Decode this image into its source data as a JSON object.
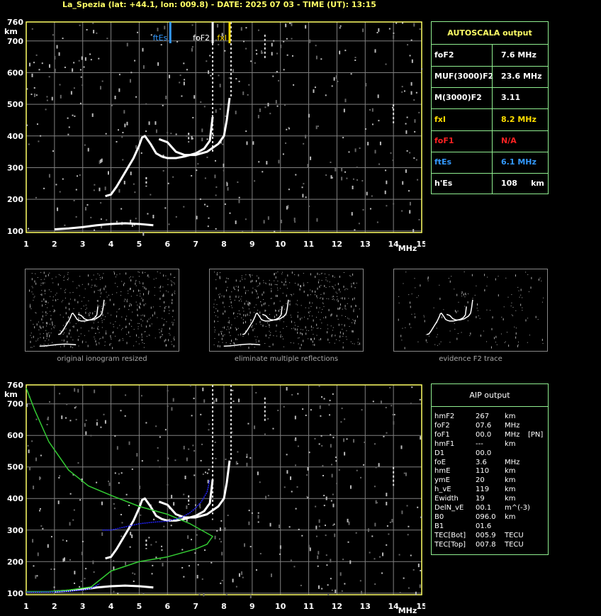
{
  "header": {
    "station": "La_Spezia",
    "text": "La_Spezia (lat: +44.1, lon: 009.8) - DATE: 2025 07 03 - TIME (UT): 13:15"
  },
  "colors": {
    "axis": "#ffff66",
    "grid": "#808080",
    "table_border": "#90ee90",
    "ftEs": "#3399ff",
    "foF2": "#ffffff",
    "fxI": "#ffdd00",
    "N_A": "#ff2222",
    "profile": "#33cc33",
    "aip_trace": "#2222ff"
  },
  "chart_data": [
    {
      "type": "scatter",
      "name": "main-ionogram",
      "xlabel": "MHz",
      "ylabel": "km",
      "xlim": [
        1,
        15
      ],
      "ylim": [
        95,
        760
      ],
      "xticks": [
        1,
        2,
        3,
        4,
        5,
        6,
        7,
        8,
        9,
        10,
        11,
        12,
        13,
        14,
        15
      ],
      "yticks": [
        100,
        200,
        300,
        400,
        500,
        600,
        700,
        760
      ],
      "grid": true,
      "markers": [
        {
          "label": "ftEs",
          "freq": 6.1,
          "color": "#3399ff"
        },
        {
          "label": "foF2",
          "freq": 7.6,
          "color": "#ffffff"
        },
        {
          "label": "fxI",
          "freq": 8.2,
          "color": "#ffdd00"
        }
      ],
      "series": [
        {
          "color": "#ffffff",
          "x": [
            3.8,
            4.0,
            4.2,
            4.4,
            4.6,
            4.8,
            5.0,
            5.1,
            5.2,
            5.4,
            5.6,
            5.8,
            6.0,
            6.3,
            6.6,
            7.0,
            7.3,
            7.5,
            7.6
          ],
          "y": [
            210,
            215,
            240,
            270,
            300,
            330,
            370,
            395,
            400,
            375,
            345,
            335,
            330,
            330,
            335,
            345,
            360,
            385,
            460
          ]
        },
        {
          "color": "#ffffff",
          "x": [
            5.7,
            6.0,
            6.3,
            6.6,
            7.0,
            7.4,
            7.8,
            8.0,
            8.1,
            8.2
          ],
          "y": [
            390,
            380,
            350,
            340,
            340,
            350,
            375,
            400,
            450,
            520
          ]
        },
        {
          "color": "#ffffff",
          "x": [
            2.0,
            2.5,
            3.0,
            3.5,
            4.0,
            4.5,
            5.0,
            5.5
          ],
          "y": [
            105,
            108,
            112,
            118,
            122,
            124,
            122,
            118
          ]
        }
      ]
    },
    {
      "type": "line",
      "name": "aip-ionogram",
      "xlabel": "MHz",
      "ylabel": "km",
      "xlim": [
        1,
        15
      ],
      "ylim": [
        95,
        760
      ],
      "xticks": [
        1,
        2,
        3,
        4,
        5,
        6,
        7,
        8,
        9,
        10,
        11,
        12,
        13,
        14,
        15
      ],
      "yticks": [
        100,
        200,
        300,
        400,
        500,
        600,
        700,
        760
      ],
      "grid": true,
      "series": [
        {
          "color": "#ffffff",
          "x": [
            3.8,
            4.0,
            4.2,
            4.4,
            4.6,
            4.8,
            5.0,
            5.1,
            5.2,
            5.4,
            5.6,
            5.8,
            6.0,
            6.3,
            6.6,
            7.0,
            7.3,
            7.5,
            7.6
          ],
          "y": [
            210,
            215,
            240,
            270,
            300,
            330,
            370,
            395,
            400,
            375,
            345,
            335,
            330,
            330,
            335,
            345,
            360,
            385,
            460
          ]
        },
        {
          "color": "#ffffff",
          "x": [
            5.7,
            6.0,
            6.3,
            6.6,
            7.0,
            7.4,
            7.8,
            8.0,
            8.1,
            8.2
          ],
          "y": [
            390,
            380,
            350,
            340,
            340,
            350,
            375,
            400,
            450,
            520
          ]
        },
        {
          "color": "#ffffff",
          "x": [
            2.0,
            2.5,
            3.0,
            3.5,
            4.0,
            4.5,
            5.0,
            5.5
          ],
          "y": [
            105,
            108,
            112,
            118,
            122,
            124,
            122,
            118
          ]
        },
        {
          "color": "#33cc33",
          "x": [
            1.0,
            1.3,
            1.8,
            2.5,
            3.2,
            4.0,
            5.0,
            6.0,
            6.8,
            7.3,
            7.6,
            7.4,
            7.0,
            6.0,
            5.0,
            4.0,
            3.3,
            2.5,
            1.8,
            1.0
          ],
          "y": [
            750,
            680,
            580,
            490,
            440,
            410,
            375,
            350,
            320,
            295,
            280,
            255,
            240,
            215,
            200,
            170,
            120,
            110,
            105,
            105
          ]
        },
        {
          "color": "#2222ff",
          "x": [
            3.7,
            4.0,
            4.5,
            5.0,
            5.5,
            6.0,
            6.5,
            6.8,
            7.0,
            7.2,
            7.4,
            7.5
          ],
          "y": [
            300,
            300,
            310,
            320,
            325,
            328,
            340,
            355,
            370,
            390,
            420,
            460
          ]
        },
        {
          "color": "#2222ff",
          "x": [
            1.0,
            2.0,
            2.5,
            3.0,
            3.3,
            3.6
          ],
          "y": [
            103,
            104,
            106,
            110,
            115,
            130
          ]
        }
      ]
    }
  ],
  "thumbnails": [
    {
      "caption": "original ionogram resized"
    },
    {
      "caption": "eliminate multiple reflections"
    },
    {
      "caption": "evidence F2 trace"
    }
  ],
  "autoscala": {
    "title": "AUTOSCALA output",
    "rows": [
      {
        "label": "foF2",
        "value": "7.6 MHz",
        "color": "#ffffff"
      },
      {
        "label": "MUF(3000)F2",
        "value": "23.6 MHz",
        "color": "#ffffff"
      },
      {
        "label": "M(3000)F2",
        "value": "3.11",
        "color": "#ffffff"
      },
      {
        "label": "fxI",
        "value": "8.2 MHz",
        "color": "#ffdd00"
      },
      {
        "label": "foF1",
        "value": "N/A",
        "color": "#ff2222"
      },
      {
        "label": "ftEs",
        "value": "6.1 MHz",
        "color": "#3399ff"
      },
      {
        "label": "h'Es",
        "value": "108     km",
        "color": "#ffffff"
      }
    ]
  },
  "aip": {
    "title": "AIP output",
    "rows": [
      {
        "p": "hmF2",
        "v": "267",
        "u": "km",
        "e": ""
      },
      {
        "p": "foF2",
        "v": "07.6",
        "u": "MHz",
        "e": ""
      },
      {
        "p": "foF1",
        "v": "00.0",
        "u": "MHz",
        "e": "[PN]"
      },
      {
        "p": "hmF1",
        "v": "---",
        "u": "km",
        "e": ""
      },
      {
        "p": "D1",
        "v": "00.0",
        "u": "",
        "e": ""
      },
      {
        "p": "foE",
        "v": "3.6",
        "u": "MHz",
        "e": ""
      },
      {
        "p": "hmE",
        "v": "110",
        "u": "km",
        "e": ""
      },
      {
        "p": "ymE",
        "v": "20",
        "u": "km",
        "e": ""
      },
      {
        "p": "h_vE",
        "v": "119",
        "u": "km",
        "e": ""
      },
      {
        "p": "Ewidth",
        "v": "19",
        "u": "km",
        "e": ""
      },
      {
        "p": "DelN_vE",
        "v": "00.1",
        "u": "m^(-3)",
        "e": ""
      },
      {
        "p": "B0",
        "v": "096.0",
        "u": "km",
        "e": ""
      },
      {
        "p": "B1",
        "v": "01.6",
        "u": "",
        "e": ""
      },
      {
        "p": "TEC[Bot]",
        "v": "005.9",
        "u": "TECU",
        "e": ""
      },
      {
        "p": "TEC[Top]",
        "v": "007.8",
        "u": "TECU",
        "e": ""
      }
    ]
  }
}
